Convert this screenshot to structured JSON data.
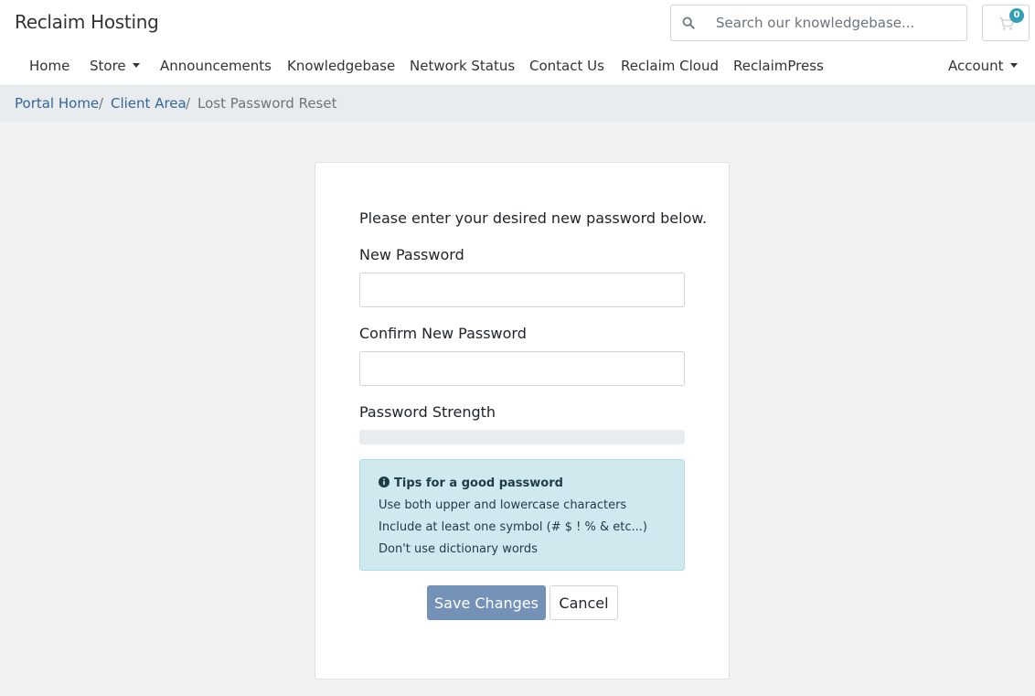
{
  "header": {
    "logo": "Reclaim Hosting",
    "search_placeholder": "Search our knowledgebase...",
    "cart_count": "0"
  },
  "nav": {
    "items": [
      "Home",
      "Store",
      "Announcements",
      "Knowledgebase",
      "Network Status",
      "Contact Us",
      "Reclaim Cloud",
      "ReclaimPress"
    ],
    "account": "Account"
  },
  "breadcrumb": [
    "Portal Home",
    "Client Area",
    "Lost Password Reset"
  ],
  "form": {
    "intro": "Please enter your desired new password below.",
    "new_password_label": "New Password",
    "new_password_value": "",
    "confirm_password_label": "Confirm New Password",
    "confirm_password_value": "",
    "strength_label": "Password Strength",
    "strength_percent": 0
  },
  "tips": {
    "title": "Tips for a good password",
    "items": [
      "Use both upper and lowercase characters",
      "Include at least one symbol (# $ ! % & etc...)",
      "Don't use dictionary words"
    ]
  },
  "buttons": {
    "save": "Save Changes",
    "cancel": "Cancel"
  },
  "colors": {
    "primary": "#336699",
    "save_button": "#7492b8",
    "tips_background": "#cfe9ef",
    "badge": "#31a0b5"
  }
}
